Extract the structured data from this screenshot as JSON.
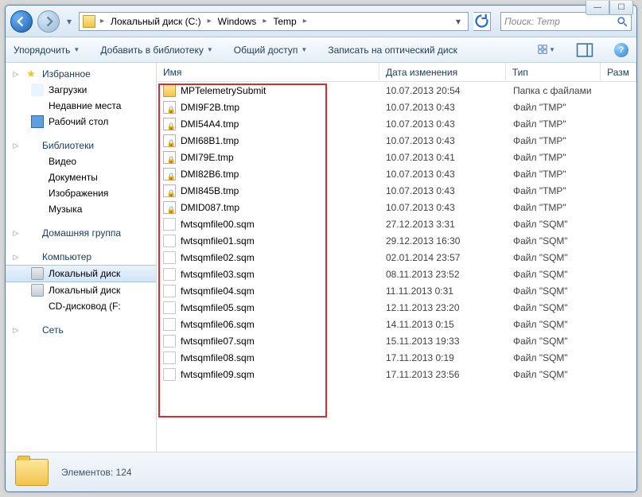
{
  "breadcrumbs": [
    "Локальный диск (C:)",
    "Windows",
    "Temp"
  ],
  "search_placeholder": "Поиск: Temp",
  "toolbar": {
    "organize": "Упорядочить",
    "add_library": "Добавить в библиотеку",
    "share": "Общий доступ",
    "burn": "Записать на оптический диск"
  },
  "nav": {
    "favorites": "Избранное",
    "downloads": "Загрузки",
    "recent": "Недавние места",
    "desktop": "Рабочий стол",
    "libraries": "Библиотеки",
    "video": "Видео",
    "documents": "Документы",
    "images": "Изображения",
    "music": "Музыка",
    "homegroup": "Домашняя группа",
    "computer": "Компьютер",
    "localdisk1": "Локальный диск",
    "localdisk2": "Локальный диск",
    "cddrive": "CD-дисковод (F:",
    "network": "Сеть"
  },
  "columns": {
    "name": "Имя",
    "date": "Дата изменения",
    "type": "Тип",
    "size": "Разм"
  },
  "type_folder": "Папка с файлами",
  "type_tmp": "Файл \"TMP\"",
  "type_sqm": "Файл \"SQM\"",
  "files": [
    {
      "icon": "folder",
      "name": "MPTelemetrySubmit",
      "date": "10.07.2013 20:54",
      "typeKey": "type_folder"
    },
    {
      "icon": "lock",
      "name": "DMI9F2B.tmp",
      "date": "10.07.2013 0:43",
      "typeKey": "type_tmp"
    },
    {
      "icon": "lock",
      "name": "DMI54A4.tmp",
      "date": "10.07.2013 0:43",
      "typeKey": "type_tmp"
    },
    {
      "icon": "lock",
      "name": "DMI68B1.tmp",
      "date": "10.07.2013 0:43",
      "typeKey": "type_tmp"
    },
    {
      "icon": "lock",
      "name": "DMI79E.tmp",
      "date": "10.07.2013 0:41",
      "typeKey": "type_tmp"
    },
    {
      "icon": "lock",
      "name": "DMI82B6.tmp",
      "date": "10.07.2013 0:43",
      "typeKey": "type_tmp"
    },
    {
      "icon": "lock",
      "name": "DMI845B.tmp",
      "date": "10.07.2013 0:43",
      "typeKey": "type_tmp"
    },
    {
      "icon": "lock",
      "name": "DMID087.tmp",
      "date": "10.07.2013 0:43",
      "typeKey": "type_tmp"
    },
    {
      "icon": "file",
      "name": "fwtsqmfile00.sqm",
      "date": "27.12.2013 3:31",
      "typeKey": "type_sqm"
    },
    {
      "icon": "file",
      "name": "fwtsqmfile01.sqm",
      "date": "29.12.2013 16:30",
      "typeKey": "type_sqm"
    },
    {
      "icon": "file",
      "name": "fwtsqmfile02.sqm",
      "date": "02.01.2014 23:57",
      "typeKey": "type_sqm"
    },
    {
      "icon": "file",
      "name": "fwtsqmfile03.sqm",
      "date": "08.11.2013 23:52",
      "typeKey": "type_sqm"
    },
    {
      "icon": "file",
      "name": "fwtsqmfile04.sqm",
      "date": "11.11.2013 0:31",
      "typeKey": "type_sqm"
    },
    {
      "icon": "file",
      "name": "fwtsqmfile05.sqm",
      "date": "12.11.2013 23:20",
      "typeKey": "type_sqm"
    },
    {
      "icon": "file",
      "name": "fwtsqmfile06.sqm",
      "date": "14.11.2013 0:15",
      "typeKey": "type_sqm"
    },
    {
      "icon": "file",
      "name": "fwtsqmfile07.sqm",
      "date": "15.11.2013 19:33",
      "typeKey": "type_sqm"
    },
    {
      "icon": "file",
      "name": "fwtsqmfile08.sqm",
      "date": "17.11.2013 0:19",
      "typeKey": "type_sqm"
    },
    {
      "icon": "file",
      "name": "fwtsqmfile09.sqm",
      "date": "17.11.2013 23:56",
      "typeKey": "type_sqm"
    }
  ],
  "status": {
    "label": "Элементов:",
    "count": "124"
  }
}
